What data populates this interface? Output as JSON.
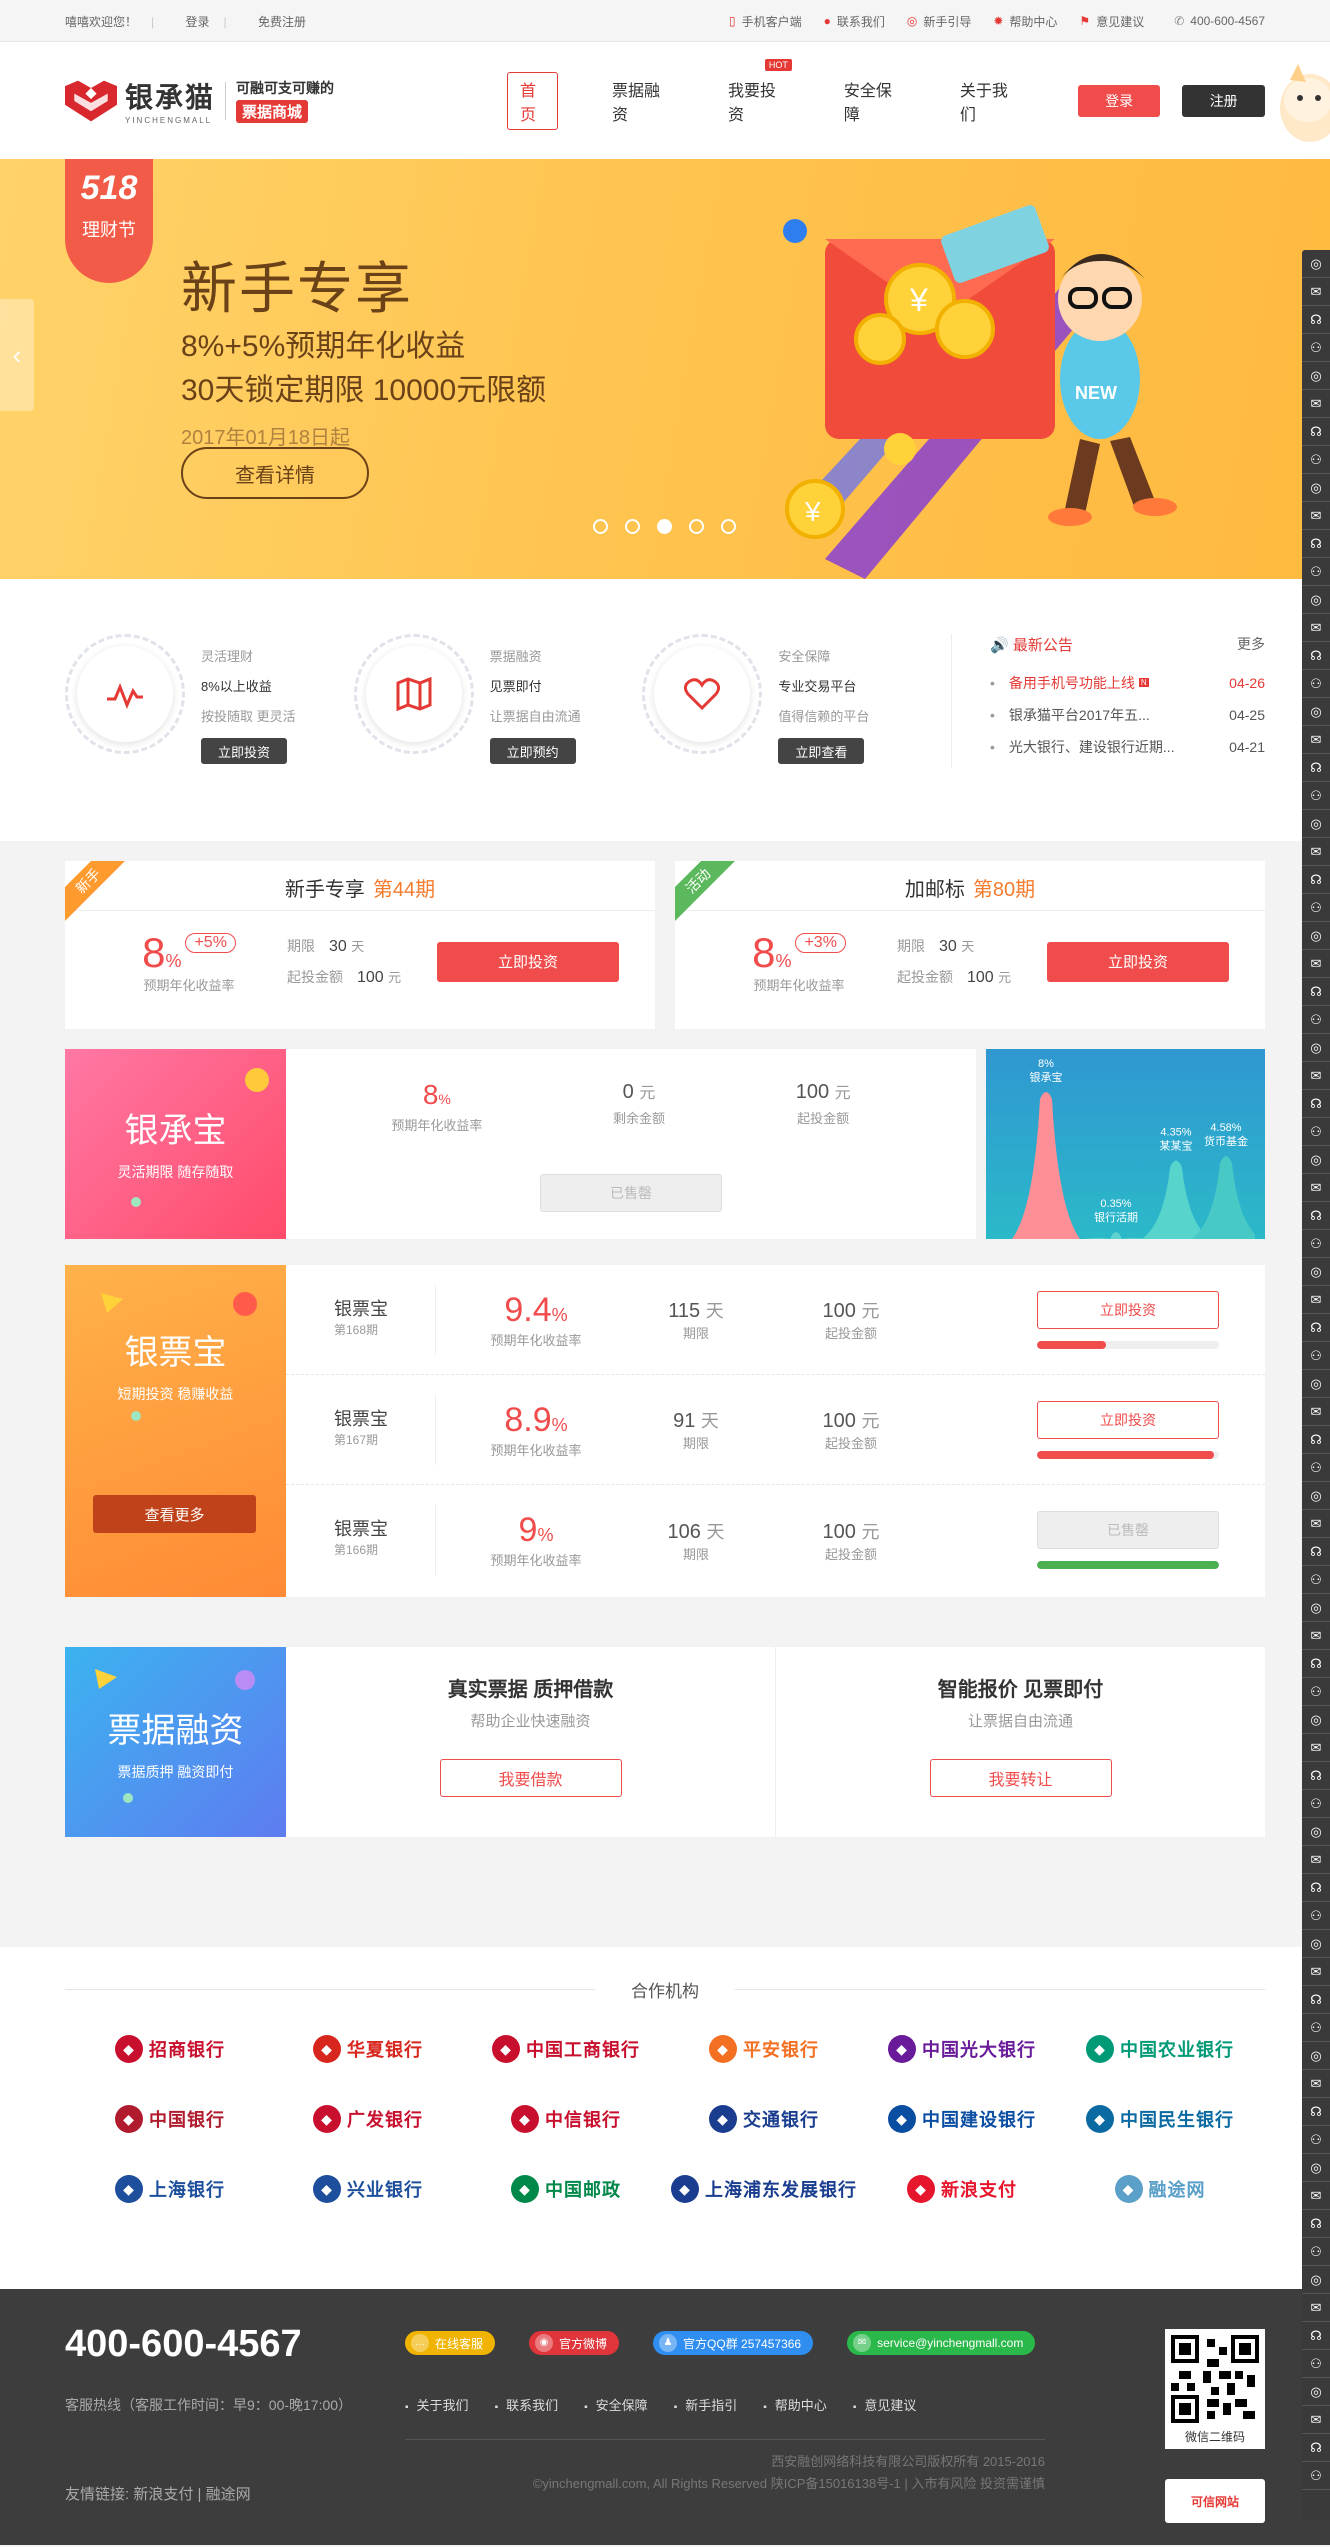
{
  "topbar": {
    "welcome": "嘻嘻欢迎您！",
    "login": "登录",
    "register": "免费注册",
    "mobile": "手机客户端",
    "contact": "联系我们",
    "guide": "新手引导",
    "help": "帮助中心",
    "feedback": "意见建议",
    "phone": "400-600-4567"
  },
  "header": {
    "brand": "银承猫",
    "brand_en": "YINCHENGMALL",
    "slogan1": "可融可支可赚的",
    "slogan2": "票据商城",
    "nav": [
      "首页",
      "票据融资",
      "我要投资",
      "安全保障",
      "关于我们"
    ],
    "hot": "HOT",
    "login": "登录",
    "register": "注册"
  },
  "banner": {
    "badge_num": "518",
    "badge_text": "理财节",
    "title": "新手专享",
    "line1": "8%+5%预期年化收益",
    "line2": "30天锁定期限  10000元限额",
    "date": "2017年01月18日起",
    "button": "查看详情"
  },
  "features": [
    {
      "title": "灵活理财",
      "main": "8%以上收益",
      "sub": "按投随取 更灵活",
      "btn": "立即投资"
    },
    {
      "title": "票据融资",
      "main": "见票即付",
      "sub": "让票据自由流通",
      "btn": "立即预约"
    },
    {
      "title": "安全保障",
      "main": "专业交易平台",
      "sub": "值得信赖的平台",
      "btn": "立即查看"
    }
  ],
  "announcements": {
    "title": "最新公告",
    "more": "更多",
    "items": [
      {
        "text": "备用手机号功能上线",
        "date": "04-26",
        "new": "N"
      },
      {
        "text": "银承猫平台2017年五...",
        "date": "04-25"
      },
      {
        "text": "光大银行、建设银行近期...",
        "date": "04-21"
      }
    ]
  },
  "promos": [
    {
      "tag": "新手",
      "tag_color": "#ff9a2e",
      "title": "新手专享",
      "period": "第44期",
      "rate": "8",
      "unit": "%",
      "add": "+5%",
      "rate_label": "预期年化收益率",
      "term_label": "期限",
      "term": "30",
      "term_unit": "天",
      "min_label": "起投金额",
      "min": "100",
      "min_unit": "元",
      "btn": "立即投资"
    },
    {
      "tag": "活动",
      "tag_color": "#5cb85c",
      "title": "加邮标",
      "period": "第80期",
      "rate": "8",
      "unit": "%",
      "add": "+3%",
      "rate_label": "预期年化收益率",
      "term_label": "期限",
      "term": "30",
      "term_unit": "天",
      "min_label": "起投金额",
      "min": "100",
      "min_unit": "元",
      "btn": "立即投资"
    }
  ],
  "ycb": {
    "title": "银承宝",
    "sub": "灵活期限 随存随取",
    "rate": "8",
    "rate_unit": "%",
    "rate_label": "预期年化收益率",
    "remain": "0",
    "remain_unit": "元",
    "remain_label": "剩余金额",
    "min": "100",
    "min_unit": "元",
    "min_label": "起投金额",
    "btn": "已售罄",
    "chart": {
      "labels": [
        {
          "v": "8%",
          "n": "银承宝"
        },
        {
          "v": "0.35%",
          "n": "银行活期"
        },
        {
          "v": "4.35%",
          "n": "某某宝"
        },
        {
          "v": "4.58%",
          "n": "货币基金"
        }
      ],
      "values": [
        8,
        0.35,
        4.35,
        4.58
      ]
    }
  },
  "ypb": {
    "title": "银票宝",
    "sub": "短期投资 稳赚收益",
    "more": "查看更多",
    "items": [
      {
        "name": "银票宝",
        "period": "第168期",
        "rate": "9.4",
        "days": "115",
        "min": "100",
        "btn": "立即投资",
        "progress": 0.38,
        "color": "#f04c4c"
      },
      {
        "name": "银票宝",
        "period": "第167期",
        "rate": "8.9",
        "days": "91",
        "min": "100",
        "btn": "立即投资",
        "progress": 0.97,
        "color": "#f04c4c"
      },
      {
        "name": "银票宝",
        "period": "第166期",
        "rate": "9",
        "days": "106",
        "min": "100",
        "btn": "已售罄",
        "progress": 1,
        "color": "#4caf50"
      }
    ],
    "labels": {
      "rate": "预期年化收益率",
      "days": "期限",
      "min": "起投金额",
      "unit_pct": "%",
      "unit_day": "天",
      "unit_yuan": "元"
    }
  },
  "finance": {
    "title": "票据融资",
    "sub": "票据质押 融资即付",
    "cells": [
      {
        "title": "真实票据 质押借款",
        "sub": "帮助企业快速融资",
        "btn": "我要借款"
      },
      {
        "title": "智能报价 见票即付",
        "sub": "让票据自由流通",
        "btn": "我要转让"
      }
    ]
  },
  "partners": {
    "title": "合作机构",
    "banks": [
      {
        "name": "招商银行",
        "color": "#c8102e"
      },
      {
        "name": "华夏银行",
        "color": "#d7261e"
      },
      {
        "name": "中国工商银行",
        "color": "#c8102e"
      },
      {
        "name": "平安银行",
        "color": "#f36f21"
      },
      {
        "name": "中国光大银行",
        "color": "#6a1b9a"
      },
      {
        "name": "中国农业银行",
        "color": "#009a76"
      },
      {
        "name": "中国银行",
        "color": "#b01c2e"
      },
      {
        "name": "广发银行",
        "color": "#c8102e"
      },
      {
        "name": "中信银行",
        "color": "#c8102e"
      },
      {
        "name": "交通银行",
        "color": "#1a3d8f"
      },
      {
        "name": "中国建设银行",
        "color": "#0a4ea2"
      },
      {
        "name": "中国民生银行",
        "color": "#0a6aa1"
      },
      {
        "name": "上海银行",
        "color": "#1d4f9c"
      },
      {
        "name": "兴业银行",
        "color": "#1d4f9c"
      },
      {
        "name": "中国邮政",
        "color": "#00874a"
      },
      {
        "name": "上海浦东发展银行",
        "color": "#1a3d8f"
      },
      {
        "name": "新浪支付",
        "color": "#e6162d"
      },
      {
        "name": "融途网",
        "color": "#5aa0c8"
      }
    ]
  },
  "footer": {
    "phone": "400-600-4567",
    "hotline": "客服热线（客服工作时间：早9：00-晚17:00）",
    "pills": [
      {
        "label": "在线客服",
        "color": "#f0b400"
      },
      {
        "label": "官方微博",
        "color": "#e0353a"
      },
      {
        "label": "官方QQ群 257457366",
        "color": "#2f8ef0"
      },
      {
        "label": "service@yinchengmall.com",
        "color": "#2bb84a"
      }
    ],
    "links": [
      "关于我们",
      "联系我们",
      "安全保障",
      "新手指引",
      "帮助中心",
      "意见建议"
    ],
    "friend": "友情链接: 新浪支付 | 融途网",
    "copy1": "西安融创网络科技有限公司版权所有  2015-2016",
    "copy2": "©yinchengmall.com, All Rights Reserved 陕ICP备15016138号-1 | 入市有风险 投资需谨慎",
    "qr_label": "微信二维码",
    "cert": "可信网站"
  }
}
